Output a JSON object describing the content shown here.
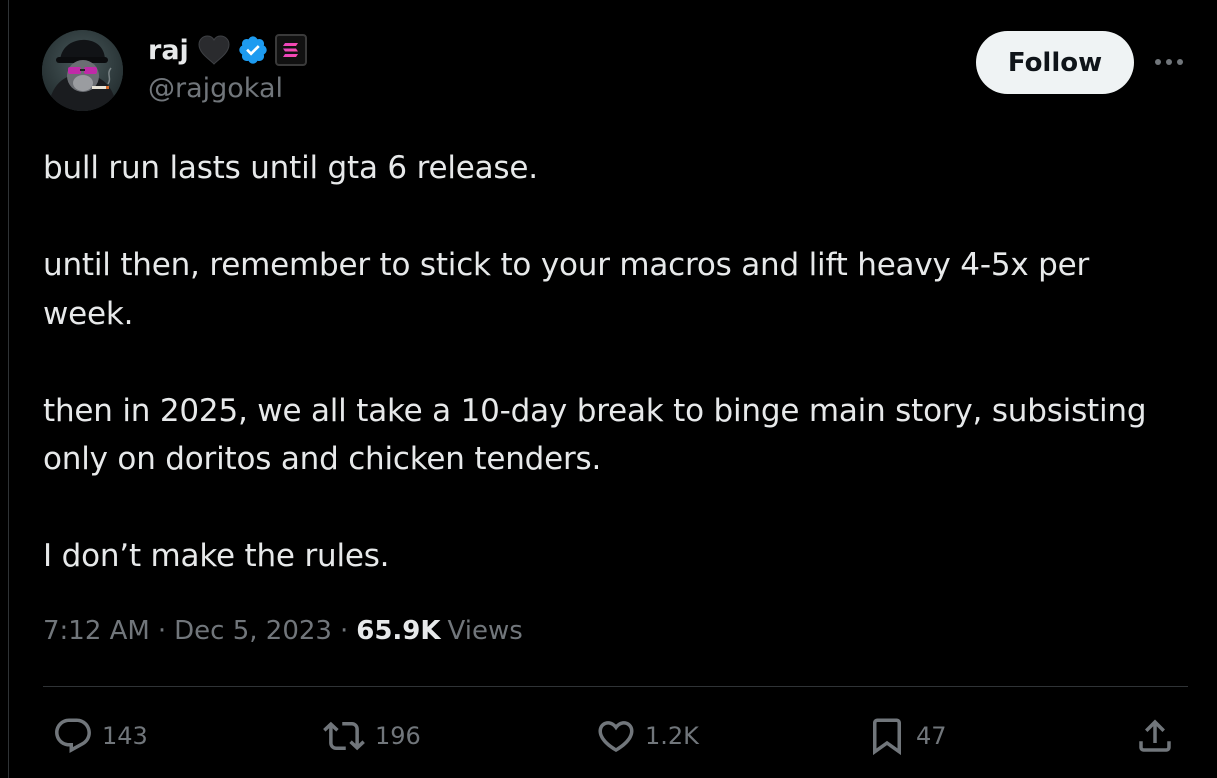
{
  "author": {
    "display_name": "raj",
    "handle": "@rajgokal",
    "emoji": "🖤",
    "verified": true
  },
  "header": {
    "follow_label": "Follow"
  },
  "tweet": {
    "paragraphs": [
      "bull run lasts until gta 6 release.",
      "until then, remember to stick to your macros and lift heavy 4-5x per week.",
      "then in 2025, we all take a 10-day break to binge main story, subsisting only on doritos and chicken tenders.",
      "I don’t make the rules."
    ]
  },
  "meta": {
    "time": "7:12 AM",
    "separator": "·",
    "date": "Dec 5, 2023",
    "views_count": "65.9K",
    "views_label": "Views"
  },
  "actions": {
    "replies": "143",
    "reposts": "196",
    "likes": "1.2K",
    "bookmarks": "47"
  },
  "colors": {
    "background": "#000000",
    "text": "#e7e9ea",
    "secondary": "#71767b",
    "verified": "#1d9bf0",
    "follow_bg": "#eff3f4",
    "solana_gradient": [
      "#9945ff",
      "#14f195"
    ]
  }
}
